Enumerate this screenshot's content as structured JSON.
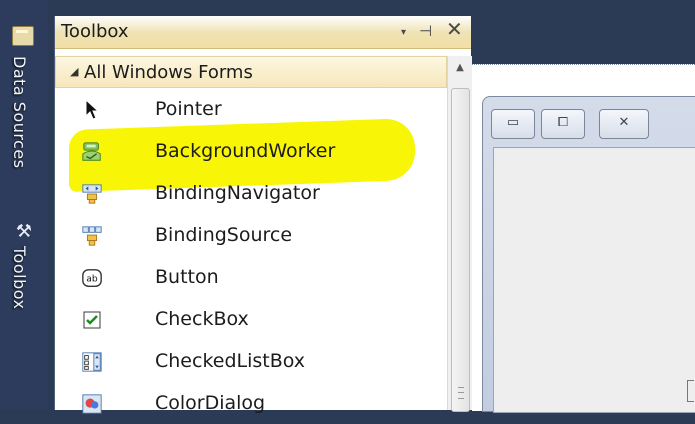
{
  "sidebar": {
    "tabs": [
      {
        "label": "Data Sources",
        "icon": "data-sources-icon"
      },
      {
        "label": "Toolbox",
        "icon": "toolbox-icon"
      }
    ]
  },
  "toolbox": {
    "title": "Toolbox",
    "header_buttons": {
      "dropdown": "▾",
      "pin": "⊣",
      "close": "✕"
    },
    "section": {
      "label": "All Windows Forms",
      "arrow": "◢",
      "expanded": true
    },
    "items": [
      {
        "label": "Pointer",
        "icon": "pointer-icon"
      },
      {
        "label": "BackgroundWorker",
        "icon": "background-worker-icon",
        "highlighted": true
      },
      {
        "label": "BindingNavigator",
        "icon": "binding-navigator-icon"
      },
      {
        "label": "BindingSource",
        "icon": "binding-source-icon"
      },
      {
        "label": "Button",
        "icon": "button-icon"
      },
      {
        "label": "CheckBox",
        "icon": "checkbox-icon"
      },
      {
        "label": "CheckedListBox",
        "icon": "checked-listbox-icon"
      },
      {
        "label": "ColorDialog",
        "icon": "color-dialog-icon"
      }
    ],
    "highlight_color": "#f9f506"
  },
  "form_window": {
    "caption_buttons": {
      "minimize": "▭",
      "maximize": "⧠",
      "close": "✕"
    }
  },
  "colors": {
    "ide_background": "#2b3a55",
    "header_gold": "#f2dfa4"
  }
}
